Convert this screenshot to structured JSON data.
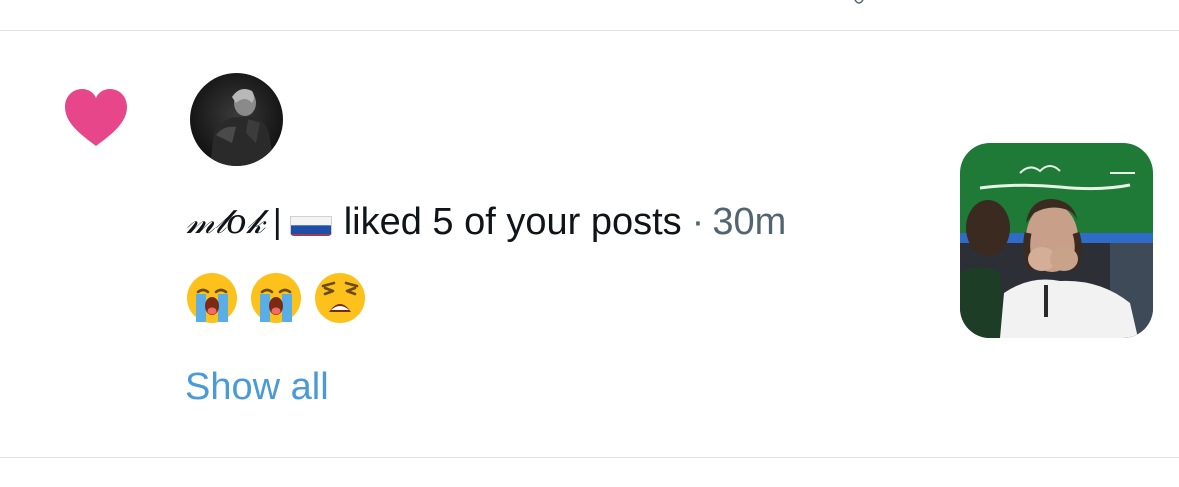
{
  "notification": {
    "type_icon": "heart-icon",
    "user": {
      "display_name": "𝓂𝓁𝑜𝓀",
      "separator": "|",
      "flag_icon": "russia-flag-icon"
    },
    "action": "liked 5 of your posts",
    "dot": "·",
    "time": "30m",
    "emojis": [
      "loudly-crying-face-icon",
      "loudly-crying-face-icon",
      "weary-face-icon"
    ],
    "show_all_label": "Show all"
  },
  "colors": {
    "heart": "#E8468A",
    "link": "#4A9AD8",
    "muted_text": "#536471",
    "divider": "#DFE2E5"
  }
}
